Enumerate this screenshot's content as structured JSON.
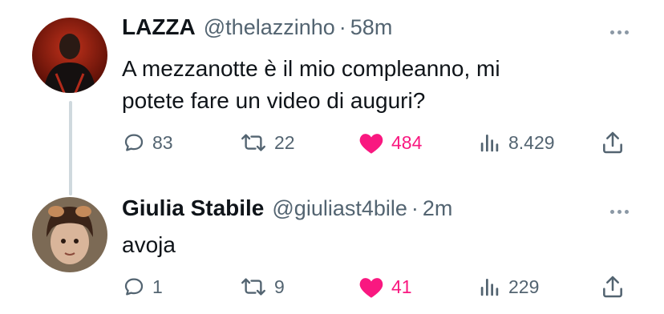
{
  "tweets": [
    {
      "author": {
        "name": "LAZZA",
        "handle": "@thelazzinho"
      },
      "separator": "·",
      "time": "58m",
      "text_lines": [
        "A mezzanotte è il mio compleanno, mi",
        "potete fare un video di auguri?"
      ],
      "stats": {
        "replies": "83",
        "retweets": "22",
        "likes": "484",
        "views": "8.429"
      },
      "liked": true
    },
    {
      "author": {
        "name": "Giulia Stabile",
        "handle": "@giuliast4bile"
      },
      "separator": "·",
      "time": "2m",
      "text_lines": [
        "avoja"
      ],
      "stats": {
        "replies": "1",
        "retweets": "9",
        "likes": "41",
        "views": "229"
      },
      "liked": true
    }
  ],
  "colors": {
    "like_pink": "#f91880",
    "secondary_text": "#536471",
    "thread_line": "#cfd9de"
  },
  "icons": [
    "reply-icon",
    "retweet-icon",
    "heart-icon",
    "views-icon",
    "share-icon",
    "more-icon"
  ]
}
